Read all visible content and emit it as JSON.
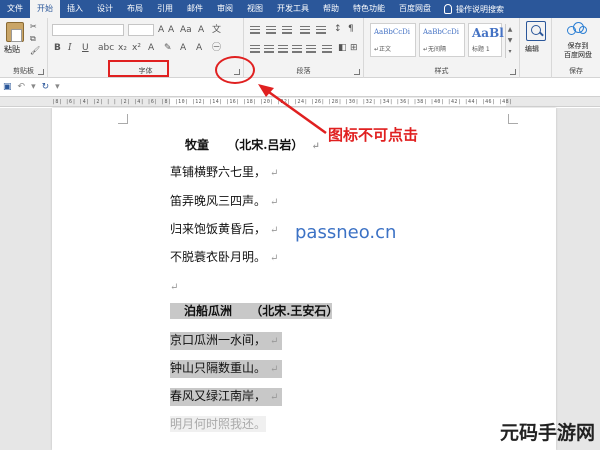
{
  "tabs": [
    "文件",
    "开始",
    "插入",
    "设计",
    "布局",
    "引用",
    "邮件",
    "审阅",
    "视图",
    "开发工具",
    "帮助",
    "特色功能",
    "百度网盘",
    "操作说明搜索"
  ],
  "ribbon": {
    "paste_label": "粘贴",
    "clipboard_label": "剪贴板",
    "font_label": "字体",
    "paragraph_label": "段落",
    "styles_label": "样式",
    "styles": [
      {
        "sample": "AaBbCcDi",
        "name": "↵正文"
      },
      {
        "sample": "AaBbCcDi",
        "name": "↵无间隔"
      },
      {
        "sample": "AaBl",
        "name": "标题 1"
      }
    ],
    "edit_label": "编辑",
    "save_label_1": "保存到",
    "save_label_2": "百度网盘",
    "save_group_label": "保存"
  },
  "ruler_text": "|8| |6| |4| |2| | | |2| |4| |6| |8| |10| |12| |14| |16| |18| |20| |22| |24| |26| |28| |30| |32| |34| |36| |38| |40| |42| |44| |46| |48|",
  "poem1": {
    "title": "牧童",
    "author": "（北宋.吕岩）",
    "lines": [
      "草铺横野六七里，",
      "笛弄晚风三四声。",
      "归来饱饭黄昏后，",
      "不脱蓑衣卧月明。"
    ]
  },
  "poem2": {
    "title": "泊船瓜洲",
    "author": "（北宋.王安石）",
    "lines": [
      "京口瓜洲一水间，",
      "钟山只隔数重山。",
      "春风又绿江南岸，",
      "明月何时照我还。"
    ]
  },
  "paragraph_mark": "↵",
  "watermark": "passneo.cn",
  "annotation": "图标不可点击",
  "brand": "元码手游网"
}
